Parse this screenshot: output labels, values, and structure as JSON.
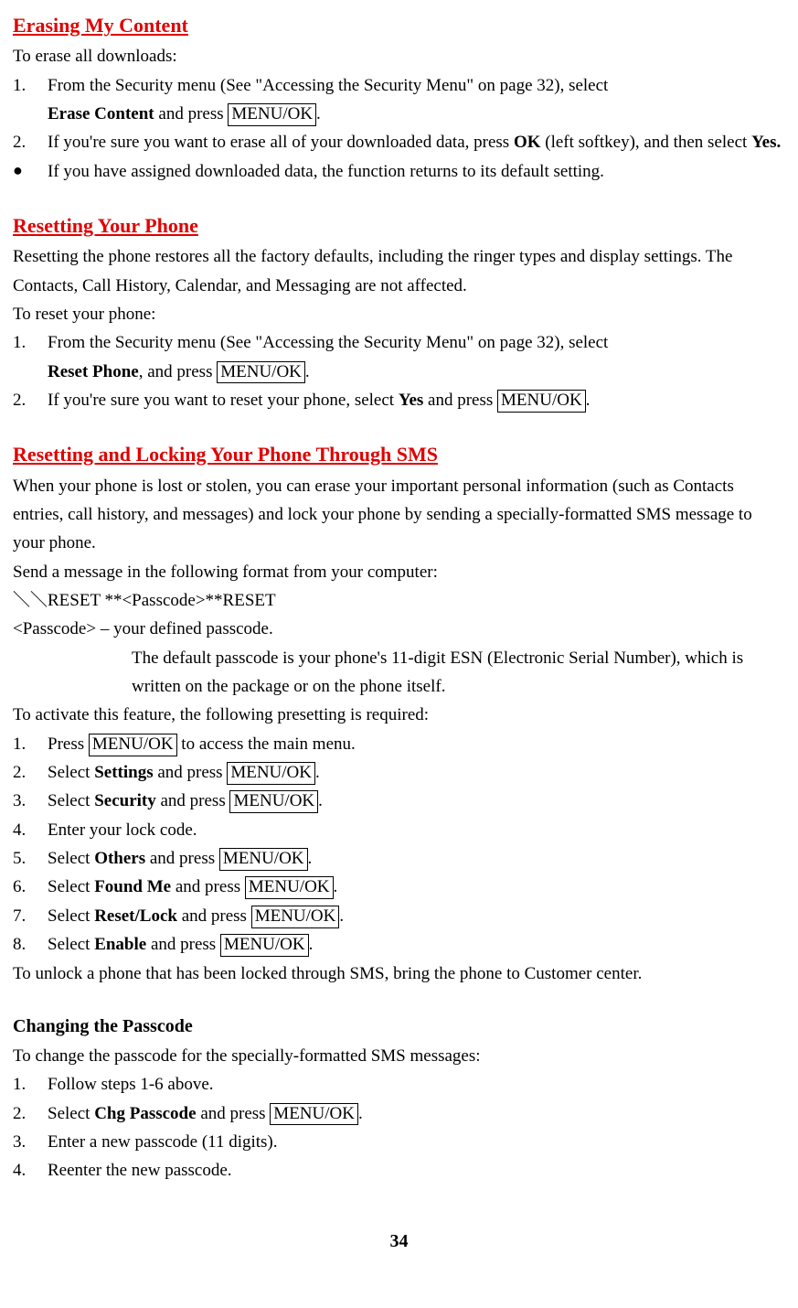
{
  "s1": {
    "heading": "Erasing My Content",
    "intro": "To erase all downloads:",
    "i1_a": "From the Security menu (See \"Accessing the Security Menu\" on page 32), select",
    "i1_b1": "Erase Content",
    "i1_b2": " and press ",
    "i1_b3": "MENU/OK",
    "i1_b4": ".",
    "i2_a": "If you're sure you want to erase all of your downloaded data, press ",
    "i2_b": "OK",
    "i2_c": " (left softkey), and then select ",
    "i2_d": "Yes.",
    "bullet": "If you have assigned downloaded data, the function returns to its default setting."
  },
  "s2": {
    "heading": "Resetting Your Phone",
    "p1": "Resetting the phone restores all the factory defaults, including the ringer types and display settings. The Contacts, Call History, Calendar, and Messaging are not affected.",
    "intro": "To reset your phone:",
    "i1_a": "From the Security menu (See \"Accessing the Security Menu\" on page 32), select",
    "i1_b1": "Reset Phone",
    "i1_b2": ", and press ",
    "i1_b3": "MENU/OK",
    "i1_b4": ".",
    "i2_a": "If you're sure you want to reset your phone, select ",
    "i2_b": "Yes",
    "i2_c": " and press ",
    "i2_d": "MENU/OK",
    "i2_e": "."
  },
  "s3": {
    "heading": "Resetting and Locking Your Phone Through SMS",
    "p1": "When your phone is lost or stolen, you can erase your important personal information (such as Contacts entries, call history, and messages) and lock your phone by sending a specially-formatted SMS message to your phone.",
    "p2": "Send a message in the following format from your computer:",
    "p3": "＼＼RESET **<Passcode>**RESET",
    "p4": "<Passcode> – your defined passcode.",
    "p5": "The default passcode is your phone's 11-digit ESN (Electronic Serial Number), which is written on the package or on the phone itself.",
    "p6": "To activate this feature, the following presetting is required:",
    "i1_a": "Press ",
    "i1_b": "MENU/OK",
    "i1_c": " to access the main menu.",
    "i2_a": "Select ",
    "i2_b": "Settings",
    "i2_c": " and press ",
    "i2_d": "MENU/OK",
    "i2_e": ".",
    "i3_a": "Select ",
    "i3_b": "Security",
    "i3_c": " and press ",
    "i3_d": "MENU/OK",
    "i3_e": ".",
    "i4": "Enter your lock code.",
    "i5_a": "Select ",
    "i5_b": "Others",
    "i5_c": " and press ",
    "i5_d": "MENU/OK",
    "i5_e": ".",
    "i6_a": "Select ",
    "i6_b": "Found Me",
    "i6_c": " and press ",
    "i6_d": "MENU/OK",
    "i6_e": ".",
    "i7_a": "Select ",
    "i7_b": "Reset/Lock",
    "i7_c": " and press ",
    "i7_d": "MENU/OK",
    "i7_e": ".",
    "i8_a": "Select ",
    "i8_b": "Enable",
    "i8_c": " and press ",
    "i8_d": "MENU/OK",
    "i8_e": ".",
    "p7": "To unlock a phone that has been locked through SMS, bring the phone to Customer center."
  },
  "s4": {
    "heading": "Changing the Passcode",
    "intro": "To change the passcode for the specially-formatted SMS messages:",
    "i1": "Follow steps 1-6 above.",
    "i2_a": "Select ",
    "i2_b": "Chg Passcode",
    "i2_c": " and press ",
    "i2_d": "MENU/OK",
    "i2_e": ".",
    "i3": "Enter a new passcode (11 digits).",
    "i4": "Reenter the new passcode."
  },
  "nums": {
    "n1": "1.",
    "n2": "2.",
    "n3": "3.",
    "n4": "4.",
    "n5": "5.",
    "n6": "6.",
    "n7": "7.",
    "n8": "8."
  },
  "bullet_char": "●",
  "page_number": "34"
}
